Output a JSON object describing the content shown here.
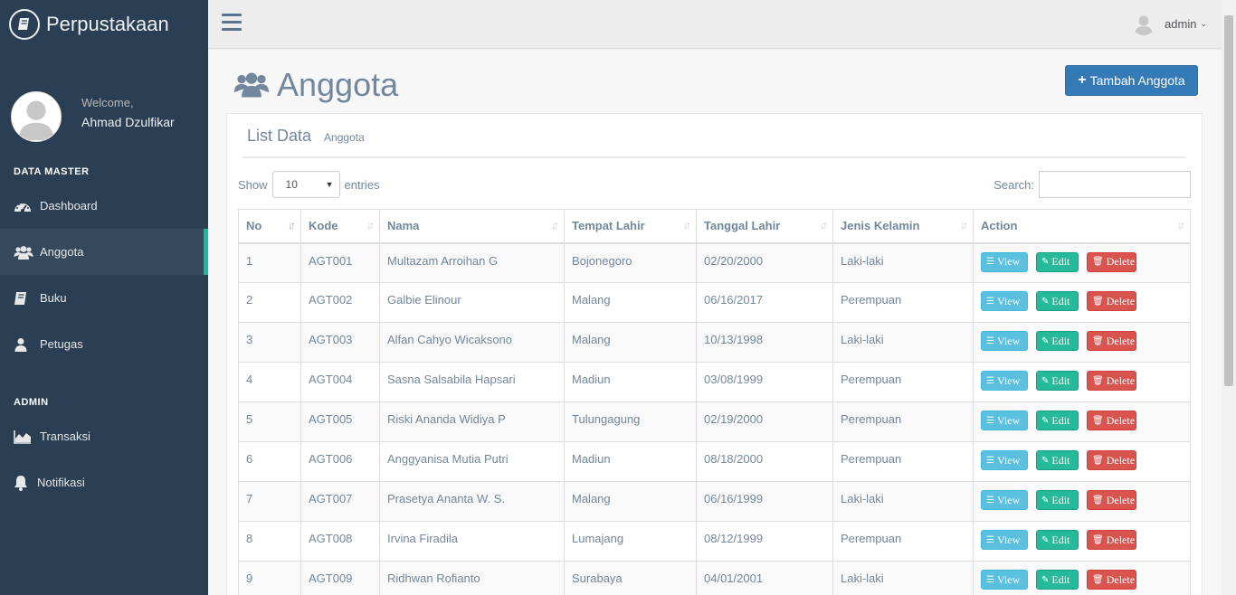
{
  "brand": {
    "title": "Perpustakaan"
  },
  "profile": {
    "welcome": "Welcome,",
    "name": "Ahmad Dzulfikar"
  },
  "sidebar": {
    "sections": [
      {
        "title": "DATA MASTER",
        "items": [
          {
            "label": "Dashboard",
            "icon": "dashboard-icon"
          },
          {
            "label": "Anggota",
            "icon": "users-icon",
            "active": true
          },
          {
            "label": "Buku",
            "icon": "book-icon"
          },
          {
            "label": "Petugas",
            "icon": "user-icon"
          }
        ]
      },
      {
        "title": "ADMIN",
        "items": [
          {
            "label": "Transaksi",
            "icon": "area-chart-icon"
          },
          {
            "label": "Notifikasi",
            "icon": "bell-icon"
          }
        ]
      }
    ]
  },
  "topnav": {
    "user": "admin"
  },
  "page": {
    "title": "Anggota",
    "add_button": "Tambah Anggota"
  },
  "panel": {
    "title": "List Data",
    "subtitle": "Anggota"
  },
  "table_controls": {
    "show_label": "Show",
    "entries_value": "10",
    "entries_label": "entries",
    "search_label": "Search:"
  },
  "table": {
    "headers": [
      "No",
      "Kode",
      "Nama",
      "Tempat Lahir",
      "Tanggal Lahir",
      "Jenis Kelamin",
      "Action"
    ],
    "action_labels": {
      "view": "View",
      "edit": "Edit",
      "delete": "Delete"
    },
    "rows": [
      [
        "1",
        "AGT001",
        "Multazam Arroihan G",
        "Bojonegoro",
        "02/20/2000",
        "Laki-laki"
      ],
      [
        "2",
        "AGT002",
        "Galbie Elinour",
        "Malang",
        "06/16/2017",
        "Perempuan"
      ],
      [
        "3",
        "AGT003",
        "Alfan Cahyo Wicaksono",
        "Malang",
        "10/13/1998",
        "Laki-laki"
      ],
      [
        "4",
        "AGT004",
        "Sasna Salsabila Hapsari",
        "Madiun",
        "03/08/1999",
        "Perempuan"
      ],
      [
        "5",
        "AGT005",
        "Riski Ananda Widiya P",
        "Tulungagung",
        "02/19/2000",
        "Perempuan"
      ],
      [
        "6",
        "AGT006",
        "Anggyanisa Mutia Putri",
        "Madiun",
        "08/18/2000",
        "Perempuan"
      ],
      [
        "7",
        "AGT007",
        "Prasetya Ananta W. S.",
        "Malang",
        "06/16/1999",
        "Laki-laki"
      ],
      [
        "8",
        "AGT008",
        "Irvina Firadila",
        "Lumajang",
        "08/12/1999",
        "Perempuan"
      ],
      [
        "9",
        "AGT009",
        "Ridhwan Rofianto",
        "Surabaya",
        "04/01/2001",
        "Laki-laki"
      ]
    ]
  },
  "colors": {
    "sidebar": "#2a3f54",
    "accent": "#1abb9c",
    "primary": "#337ab7"
  }
}
